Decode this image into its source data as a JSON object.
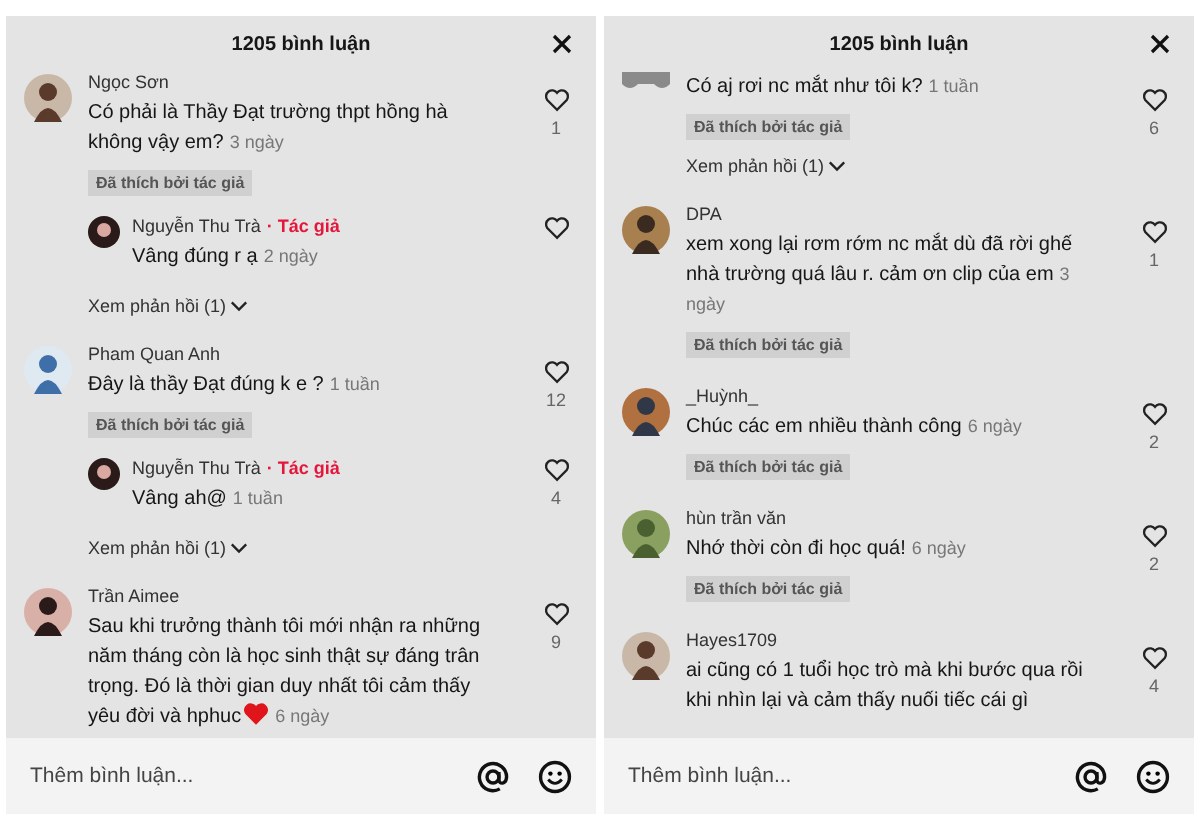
{
  "panels": [
    {
      "title": "1205 bình luận",
      "comments": [
        {
          "name": "Ngọc Sơn",
          "text": "Có phải là Thầy Đạt trường thpt hồng hà không vậy em?",
          "time": "3 ngày",
          "liked_by_author": true,
          "badge": "Đã thích bởi tác giả",
          "likes": "1",
          "replies": [
            {
              "name": "Nguyễn Thu Trà",
              "author_tag": "· Tác giả",
              "text": "Vâng đúng r ạ",
              "time": "2 ngày"
            }
          ],
          "view_replies": "Xem phản hồi (1)"
        },
        {
          "name": "Pham Quan Anh",
          "text": "Đây là thầy Đạt đúng k e ?",
          "time": "1 tuần",
          "liked_by_author": true,
          "badge": "Đã thích bởi tác giả",
          "likes": "12",
          "replies": [
            {
              "name": "Nguyễn Thu Trà",
              "author_tag": "· Tác giả",
              "text": "Vâng ah@",
              "time": "1 tuần",
              "likes": "4"
            }
          ],
          "view_replies": "Xem phản hồi (1)"
        },
        {
          "name": "Trần Aimee",
          "text": "Sau khi trưởng thành tôi mới nhận ra những năm tháng còn là học sinh thật sự đáng trân trọng. Đó là thời gian duy nhất tôi cảm thấy yêu đời và hphuc",
          "heart_emoji": true,
          "time": "6 ngày",
          "liked_by_author": false,
          "likes": "9"
        }
      ],
      "input": {
        "placeholder": "Thêm bình luận..."
      }
    },
    {
      "title": "1205 bình luận",
      "comments": [
        {
          "avatar_cut": true,
          "text": "Có aj rơi nc mắt như tôi k?",
          "time": "1 tuần",
          "liked_by_author": true,
          "badge": "Đã thích bởi tác giả",
          "likes": "6",
          "view_replies": "Xem phản hồi (1)"
        },
        {
          "name": "DPA",
          "text": "xem xong lại rơm rớm nc mắt dù đã rời ghế nhà trường quá lâu r. cảm ơn clip của em",
          "time": "3 ngày",
          "liked_by_author": true,
          "badge": "Đã thích bởi tác giả",
          "likes": "1"
        },
        {
          "name": "_Huỳnh_",
          "text": "Chúc các em nhiều thành công",
          "time": "6 ngày",
          "liked_by_author": true,
          "badge": "Đã thích bởi tác giả",
          "likes": "2"
        },
        {
          "name": "hùn trần văn",
          "text": "Nhớ thời còn đi học quá!",
          "time": "6 ngày",
          "liked_by_author": true,
          "badge": "Đã thích bởi tác giả",
          "likes": "2"
        },
        {
          "name": "Hayes1709",
          "text": "ai cũng có 1 tuổi học trò mà khi bước qua rồi khi nhìn lại và cảm thấy nuối tiếc cái gì",
          "liked_by_author": false,
          "likes": "4"
        }
      ],
      "input": {
        "placeholder": "Thêm bình luận..."
      }
    }
  ]
}
